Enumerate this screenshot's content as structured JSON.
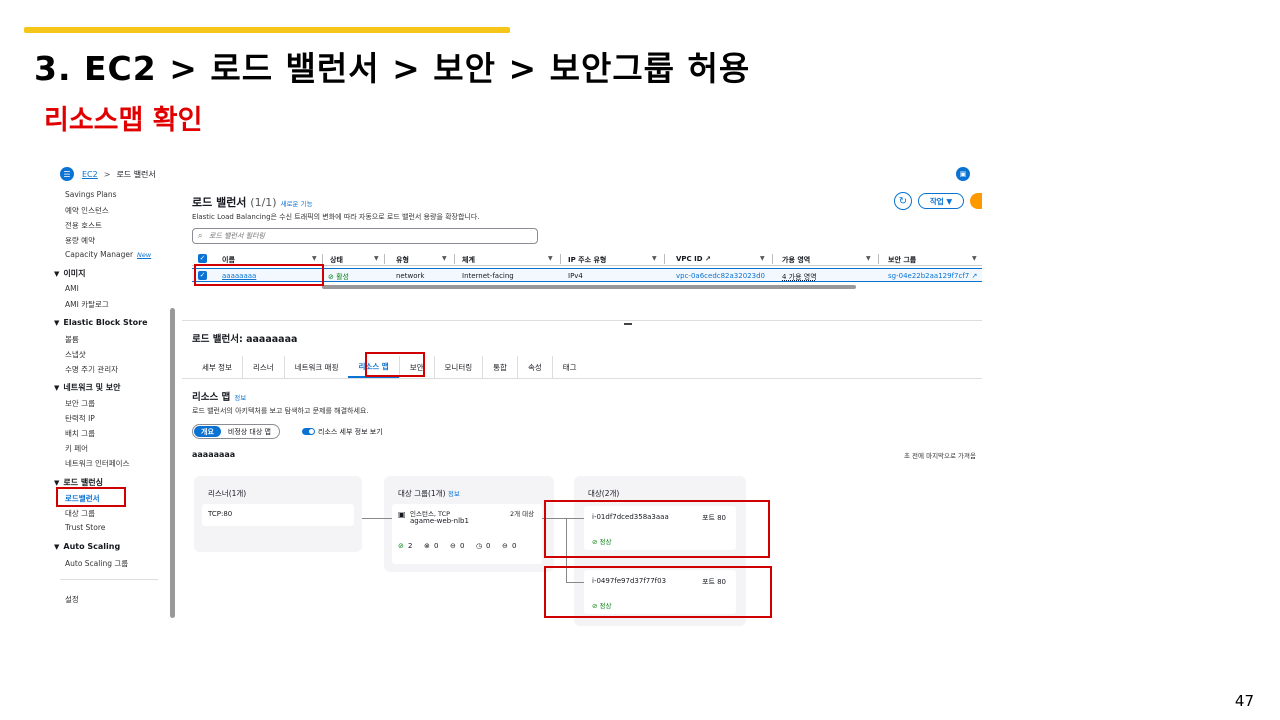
{
  "slide": {
    "title": "3. EC2 > 로드 밸런서 > 보안 > 보안그룹 허용",
    "subtitle": "리소스맵 확인",
    "page_number": "47"
  },
  "topbar": {
    "crumb_ec2": "EC2",
    "crumb_sep": ">",
    "crumb_current": "로드 밸런서"
  },
  "sidebar": {
    "items_top": [
      "Savings Plans",
      "예약 인스턴스",
      "전용 호스트",
      "용량 예약"
    ],
    "capacity_manager": "Capacity Manager",
    "new_badge": "New",
    "sec_images": "이미지",
    "images": [
      "AMI",
      "AMI 카탈로그"
    ],
    "sec_ebs": "Elastic Block Store",
    "ebs": [
      "볼륨",
      "스냅샷",
      "수명 주기 관리자"
    ],
    "sec_network": "네트워크 및 보안",
    "network": [
      "보안 그룹",
      "탄력적 IP",
      "배치 그룹",
      "키 페어",
      "네트워크 인터페이스"
    ],
    "sec_lb": "로드 밸런싱",
    "lb": [
      "로드밸런서",
      "대상 그룹",
      "Trust Store"
    ],
    "sec_as": "Auto Scaling",
    "as": [
      "Auto Scaling 그룹"
    ],
    "settings": "설정"
  },
  "lb_list": {
    "title": "로드 밸런서",
    "count": "(1/1)",
    "new_feature": "새로운 기능",
    "description": "Elastic Load Balancing은 수신 트래픽의 변화에 따라 자동으로 로드 밸런서 용량을 확장합니다.",
    "actions_label": "작업 ▼",
    "filter_placeholder": "로드 밸런서 필터링",
    "columns": [
      "이름",
      "상태",
      "유형",
      "체계",
      "IP 주소 유형",
      "VPC ID",
      "가용 영역",
      "보안 그룹"
    ],
    "row": {
      "name": "aaaaaaaa",
      "state": "활성",
      "type": "network",
      "scheme": "Internet-facing",
      "ip_type": "IPv4",
      "vpc_id": "vpc-0a6cedc82a32023d0",
      "az": "4 가용 영역",
      "sg": "sg-04e22b2aa129f7cf7"
    }
  },
  "detail": {
    "title": "로드 밸런서: aaaaaaaa",
    "tabs": [
      "세부 정보",
      "리스너",
      "네트워크 매핑",
      "리소스 맵",
      "보안",
      "모니터링",
      "통합",
      "속성",
      "태그"
    ],
    "active_tab": "리소스 맵"
  },
  "resource_map": {
    "title": "리소스 맵",
    "info": "정보",
    "description": "로드 밸런서의 아키텍처를 보고 탐색하고 문제를 해결하세요.",
    "seg_overview": "개요",
    "seg_unhealthy": "비정상 대상 맵",
    "toggle_label": "리소스 세부 정보 보기",
    "lb_name": "aaaaaaaa",
    "updated": "초 전에 마지막으로 가져옴",
    "listeners_title": "리스너(1개)",
    "listener": "TCP:80",
    "tg_title": "대상 그룹(1개)",
    "tg_info": "정보",
    "tg_type": "인스턴스, TCP",
    "tg_name": "agame-web-nlb1",
    "tg_targets": "2개 대상",
    "tg_stats": [
      "2",
      "0",
      "0",
      "0",
      "0"
    ],
    "targets_title": "대상(2개)",
    "targets": [
      {
        "id": "i-01df7dced358a3aaa",
        "port": "포트 80",
        "health": "정상"
      },
      {
        "id": "i-0497fe97d37f77f03",
        "port": "포트 80",
        "health": "정상"
      }
    ]
  }
}
